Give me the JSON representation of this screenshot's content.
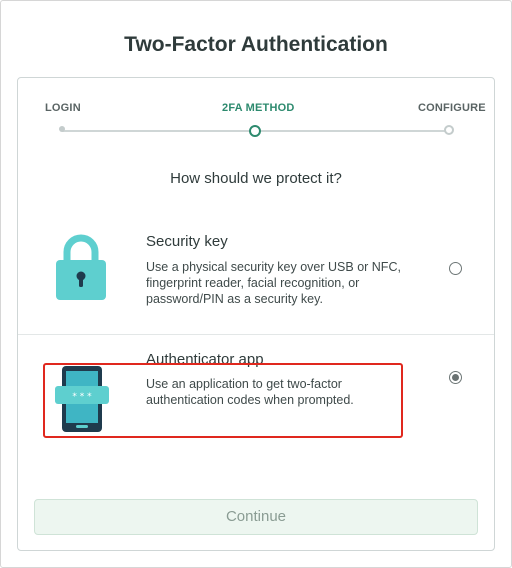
{
  "page": {
    "title": "Two-Factor Authentication"
  },
  "steps": [
    {
      "label": "LOGIN",
      "state": "done"
    },
    {
      "label": "2FA METHOD",
      "state": "current"
    },
    {
      "label": "CONFIGURE",
      "state": "upcoming"
    }
  ],
  "question": "How should we protect it?",
  "options": {
    "security_key": {
      "title": "Security key",
      "description": "Use a physical security key over USB or NFC, fingerprint reader, facial recognition, or password/PIN as a security key.",
      "icon": "padlock-icon",
      "selected": false
    },
    "authenticator_app": {
      "title": "Authenticator app",
      "description": "Use an application to get two-factor authentication codes when prompted.",
      "icon": "phone-password-icon",
      "selected": true
    }
  },
  "continue_label": "Continue",
  "colors": {
    "accent": "#2d8a6e",
    "icon_teal": "#5ecfcf",
    "phone_dark": "#1f3b4d",
    "highlight": "#e0281e",
    "continue_bg": "#edf6f0"
  }
}
